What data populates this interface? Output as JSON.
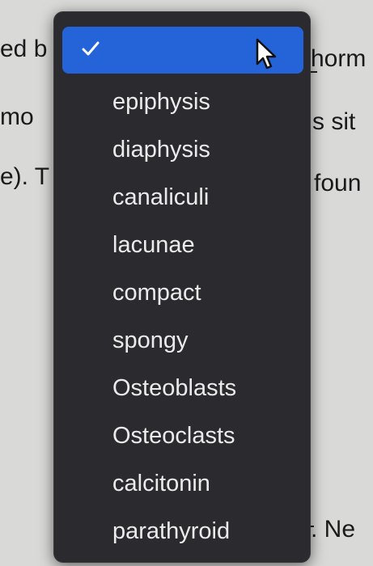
{
  "background_text": {
    "left_lines": [
      "ed b",
      "mo",
      "e). T"
    ],
    "right_lines": [
      "horm",
      "s sit",
      "foun",
      ". Ne"
    ]
  },
  "dropdown": {
    "selected_value": "",
    "options": [
      "epiphysis",
      "diaphysis",
      "canaliculi",
      "lacunae",
      "compact",
      "spongy",
      "Osteoblasts",
      "Osteoclasts",
      "calcitonin",
      "parathyroid"
    ]
  }
}
